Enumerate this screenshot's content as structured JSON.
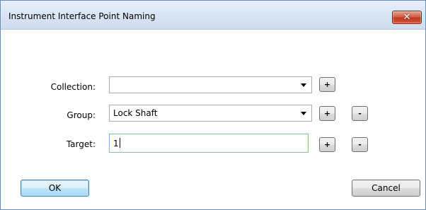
{
  "window": {
    "title": "Instrument Interface Point Naming",
    "close_glyph": "✕"
  },
  "form": {
    "collection": {
      "label": "Collection:",
      "value": "",
      "add_label": "+"
    },
    "group": {
      "label": "Group:",
      "value": "Lock Shaft",
      "add_label": "+",
      "remove_label": "-"
    },
    "target": {
      "label": "Target:",
      "value": "1",
      "add_label": "+",
      "remove_label": "-"
    }
  },
  "buttons": {
    "ok_label": "OK",
    "cancel_label": "Cancel"
  },
  "colors": {
    "accent": "#3c7fb1",
    "close": "#c0391f"
  }
}
